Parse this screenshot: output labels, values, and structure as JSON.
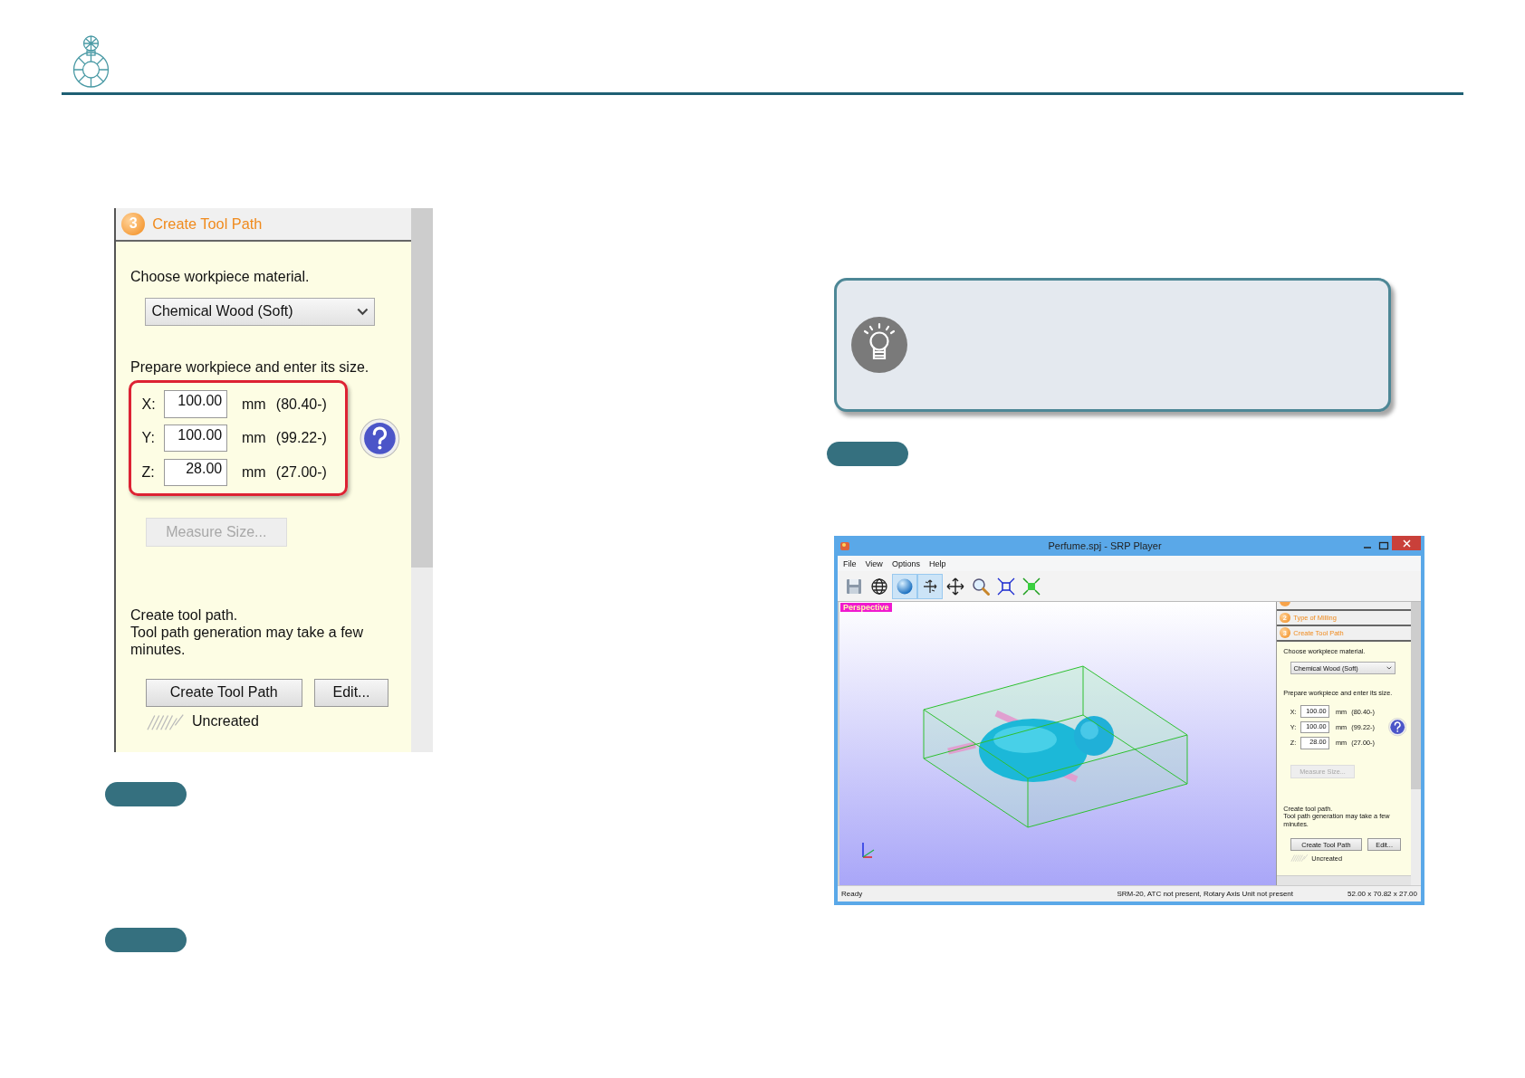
{
  "panel": {
    "steps": [
      {
        "number": "3",
        "title": "Create Tool Path"
      }
    ],
    "material_label": "Choose workpiece material.",
    "material": "Chemical Wood (Soft)",
    "size_label": "Prepare workpiece and enter its size.",
    "highlighted": true,
    "sizes": [
      {
        "axis": "X:",
        "value": "100.00",
        "unit": "mm",
        "minimum": "(80.40-)"
      },
      {
        "axis": "Y:",
        "value": "100.00",
        "unit": "mm",
        "minimum": "(99.22-)"
      },
      {
        "axis": "Z:",
        "value": "28.00",
        "unit": "mm",
        "minimum": "(27.00-)"
      }
    ],
    "measure_button": {
      "label": "Measure Size...",
      "disabled": true
    },
    "toolpath_label": "Create tool path.",
    "toolpath_note": "Tool path generation may take a few minutes.",
    "buttons": [
      "Create Tool Path",
      "Edit..."
    ],
    "status": "Uncreated"
  },
  "app": {
    "title": "Perfume.spj - SRP Player",
    "menu": [
      "File",
      "View",
      "Options",
      "Help"
    ],
    "toolbar": [
      {
        "kind": "save",
        "selected": false
      },
      {
        "kind": "globe",
        "selected": false
      },
      {
        "kind": "sphere",
        "selected": true
      },
      {
        "kind": "rotate",
        "selected": true
      },
      {
        "kind": "pan",
        "selected": false
      },
      {
        "kind": "zoom",
        "selected": false
      },
      {
        "kind": "fit",
        "selected": false
      },
      {
        "kind": "center",
        "selected": false
      }
    ],
    "view_label": "Perspective",
    "panel": {
      "steps": [
        {
          "number": "2",
          "title": "Type of Milling"
        },
        {
          "number": "3",
          "title": "Create Tool Path"
        }
      ],
      "material_label": "Choose workpiece material.",
      "material": "Chemical Wood (Soft)",
      "size_label": "Prepare workpiece and enter its size.",
      "highlighted": false,
      "sizes": [
        {
          "axis": "X:",
          "value": "100.00",
          "unit": "mm",
          "minimum": "(80.40-)"
        },
        {
          "axis": "Y:",
          "value": "100.00",
          "unit": "mm",
          "minimum": "(99.22-)"
        },
        {
          "axis": "Z:",
          "value": "28.00",
          "unit": "mm",
          "minimum": "(27.00-)"
        }
      ],
      "measure_button": {
        "label": "Measure Size...",
        "disabled": true
      },
      "toolpath_label": "Create tool path.",
      "toolpath_note": "Tool path generation may take a few minutes.",
      "buttons": [
        "Create Tool Path",
        "Edit..."
      ],
      "status": "Uncreated"
    },
    "status_bar": [
      "Ready",
      "SRM-20, ATC not present, Rotary Axis Unit not present",
      "52.00 x 70.82 x 27.00"
    ]
  }
}
